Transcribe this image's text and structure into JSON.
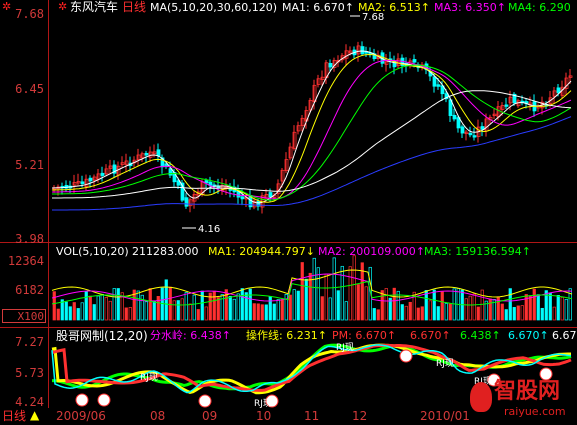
{
  "header": {
    "stock": "东风汽车",
    "period": "日线",
    "ma_params": "MA(5,10,20,30,60,120)",
    "ma1": "MA1: 6.670↑",
    "ma2": "MA2: 6.513↑",
    "ma3": "MA3: 6.350↑",
    "ma4": "MA4: 6.290"
  },
  "price_axis": [
    "7.68",
    "6.45",
    "5.21",
    "3.98"
  ],
  "price_marks": {
    "high": "7.68",
    "low": "4.16"
  },
  "volume": {
    "params": "VOL(5,10,20)",
    "value": "211283.000",
    "ma1": "MA1: 204944.797↓",
    "ma2": "MA2: 200109.000↑",
    "ma3": "MA3: 159136.594↑",
    "axis": [
      "12364",
      "6182",
      "X100"
    ]
  },
  "indicator": {
    "name": "股哥网制(12,20)",
    "water_label": "分水岭: 6.438↑",
    "op_label": "操作线: 6.231↑",
    "pm": "PM: 6.670↑",
    "v1": "6.670↑",
    "v2": "6.438↑",
    "v3": "6.670↑",
    "v4": "6.67",
    "axis": [
      "7.27",
      "5.73",
      "4.24"
    ],
    "marks": [
      "RJ现",
      "RJ现",
      "RJ现",
      "RJ现",
      "RJ现"
    ]
  },
  "footer": {
    "period_label": "日线",
    "dates": [
      "2009/06",
      "08",
      "09",
      "10",
      "11",
      "12",
      "2010/01"
    ]
  },
  "watermark": {
    "name": "智股网",
    "url": "raiyue.com"
  },
  "colors": {
    "axis_red": "#d23a3a",
    "ma1": "#ffffff",
    "ma2": "#ffff00",
    "ma3": "#ff00ff",
    "ma4": "#00ff00",
    "ma5": "#ffffff",
    "ma6": "#2a3cff",
    "up": "#ff3030",
    "down": "#00ffff"
  }
}
